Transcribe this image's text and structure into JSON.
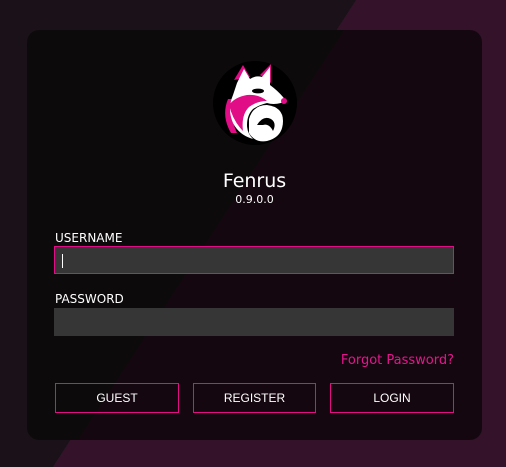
{
  "app": {
    "name": "Fenrus",
    "version": "0.9.0.0"
  },
  "logo": {
    "icon": "fenrus-fox-logo-icon"
  },
  "form": {
    "username_label": "USERNAME",
    "username_value": "",
    "password_label": "PASSWORD",
    "password_value": "",
    "forgot_password": "Forgot Password?"
  },
  "buttons": {
    "guest": "GUEST",
    "register": "REGISTER",
    "login": "LOGIN"
  },
  "colors": {
    "accent": "#e00d87",
    "card_background": "#0d0a0c",
    "input_background": "#363636",
    "page_background": "#33122a"
  }
}
